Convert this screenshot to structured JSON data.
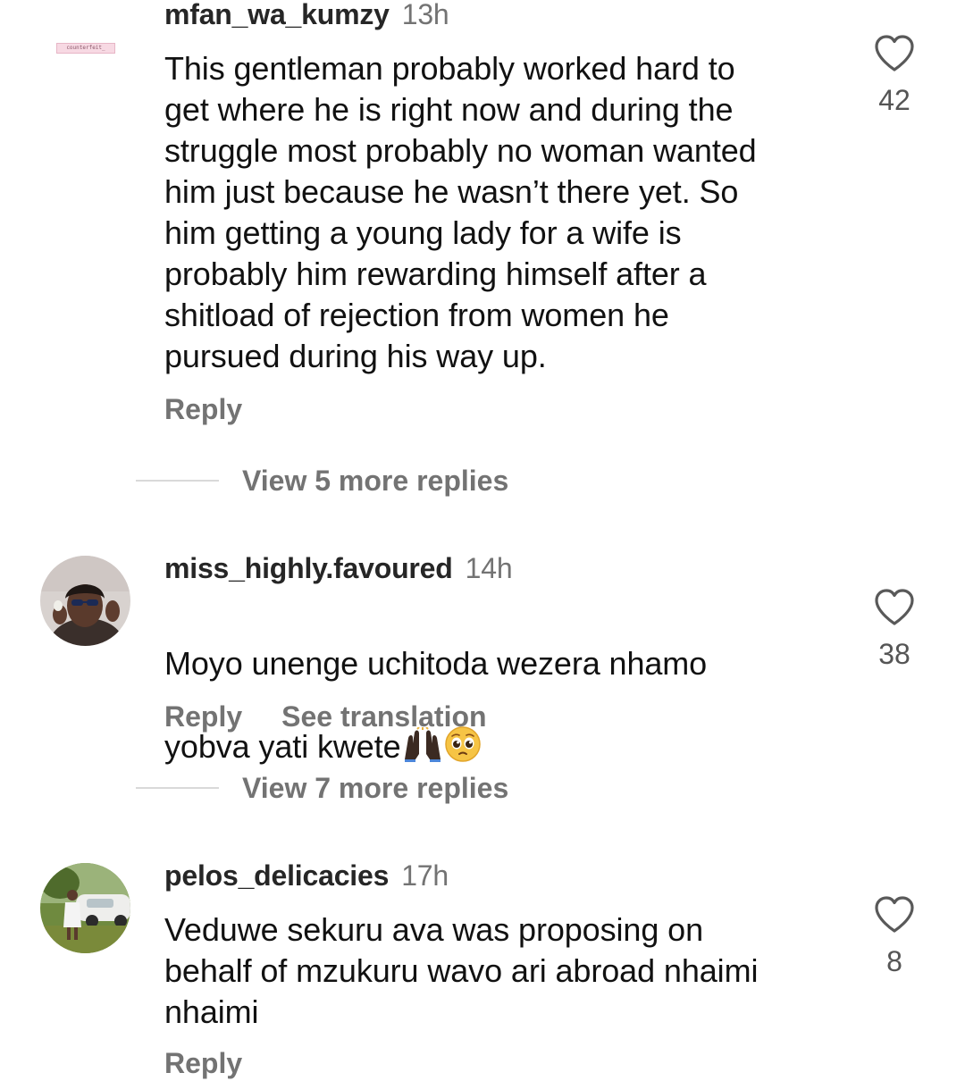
{
  "comments": [
    {
      "username": "mfan_wa_kumzy",
      "time": "13h",
      "avatar_text": "counterfeit_",
      "text": "This gentleman probably worked hard to\nget where he is right now and during the\nstruggle most probably no woman wanted\nhim just because he wasn’t there yet. So\nhim getting a young lady for a wife is\nprobably him rewarding himself after a\nshitload of rejection from women he\npursued during his way up.",
      "likes": "42",
      "reply_label": "Reply",
      "view_more": "View 5 more replies"
    },
    {
      "username": "miss_highly.favoured",
      "time": "14h",
      "text_line1": "Moyo unenge uchitoda wezera nhamo",
      "text_line2": "yobva yati kwete",
      "likes": "38",
      "reply_label": "Reply",
      "translate_label": "See translation",
      "view_more": "View 7 more replies"
    },
    {
      "username": "pelos_delicacies",
      "time": "17h",
      "text": "Veduwe sekuru ava was proposing on\nbehalf of mzukuru wavo ari abroad nhaimi\nnhaimi",
      "likes": "8",
      "reply_label": "Reply"
    }
  ],
  "icons": {
    "like": "heart-outline-icon",
    "emoji_1": "raised-hands-emoji",
    "emoji_2": "pleading-face-emoji"
  },
  "colors": {
    "username": "#262626",
    "meta": "#737373",
    "divider": "#d9d9d9"
  }
}
